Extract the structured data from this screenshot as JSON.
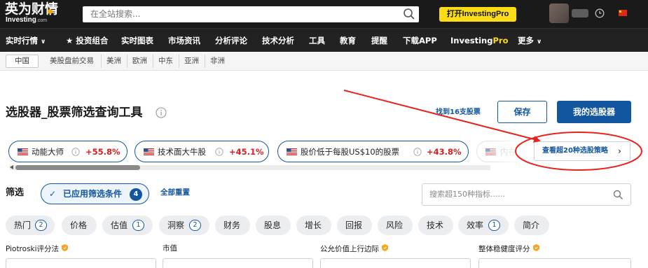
{
  "header": {
    "logo_main": "英为财情",
    "logo_sub": "Investing",
    "logo_domain": ".com",
    "search_placeholder": "在全站搜索...",
    "pro_button": "打开InvestingPro"
  },
  "nav": {
    "items": [
      "实时行情",
      "★ 投资组合",
      "实时图表",
      "市场资讯",
      "分析评论",
      "技术分析",
      "工具",
      "教育",
      "提醒",
      "下载APP"
    ],
    "pro_prefix": "Investing",
    "pro_suffix": "Pro",
    "more": "更多"
  },
  "regions": {
    "active": "中国",
    "items": [
      "美股盘前交易",
      "美洲",
      "欧洲",
      "中东",
      "亚洲",
      "非洲"
    ]
  },
  "page": {
    "title": "选股器_股票筛选查询工具",
    "found_text": "找到16支股票",
    "save_button": "保存",
    "my_screener_button": "我的选股器"
  },
  "strategies": [
    {
      "name": "动能大师",
      "return": "+55.8%"
    },
    {
      "name": "技术面大牛股",
      "return": "+45.1%"
    },
    {
      "name": "股价低于每股US$10的股票",
      "return": "+43.8%"
    },
    {
      "name": "内在",
      "return": ""
    }
  ],
  "more_strategies": "查看超20种选股策略",
  "filters": {
    "label": "筛选",
    "applied_label": "已应用筛选条件",
    "applied_count": "4",
    "reset": "全部重置",
    "metric_search_placeholder": "搜索超150种指标......"
  },
  "categories": [
    {
      "label": "热门",
      "count": "2"
    },
    {
      "label": "价格",
      "count": ""
    },
    {
      "label": "估值",
      "count": "1"
    },
    {
      "label": "洞察",
      "count": "2"
    },
    {
      "label": "财务",
      "count": ""
    },
    {
      "label": "股息",
      "count": ""
    },
    {
      "label": "增长",
      "count": ""
    },
    {
      "label": "回报",
      "count": ""
    },
    {
      "label": "风险",
      "count": ""
    },
    {
      "label": "技术",
      "count": ""
    },
    {
      "label": "效率",
      "count": "1"
    },
    {
      "label": "简介",
      "count": ""
    }
  ],
  "columns": [
    {
      "label": "Piotroski评分法",
      "pro": true
    },
    {
      "label": "市值",
      "pro": false
    },
    {
      "label": "公允价值上行边际",
      "pro": true
    },
    {
      "label": "整体稳健度评分",
      "pro": true
    }
  ],
  "colors": {
    "brand_blue": "#1256a0",
    "pro_yellow": "#fbdc16",
    "return_red": "#d81e1e",
    "annotation_red": "#e8231c"
  }
}
